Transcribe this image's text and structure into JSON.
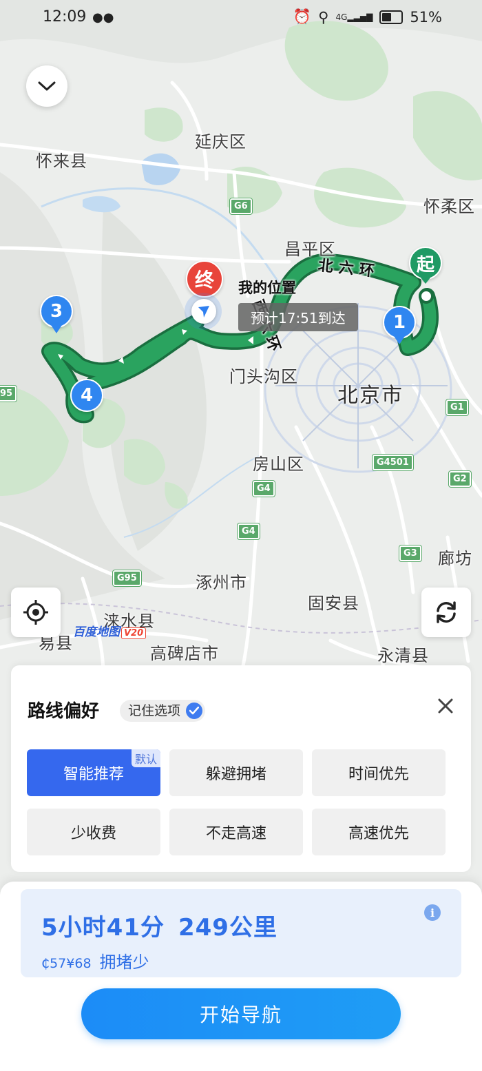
{
  "status_bar": {
    "time": "12:09",
    "network": "4G",
    "battery": "51%"
  },
  "map": {
    "places": {
      "yanqing": "延庆区",
      "huailai": "怀来县",
      "huairou": "怀柔区",
      "changping": "昌平区",
      "mentougou": "门头沟区",
      "beijing": "北京市",
      "fangshan": "房山区",
      "langfang": "廊坊",
      "zhuozhou": "涿州市",
      "guan": "固安县",
      "laishui": "涞水县",
      "yixian": "易县",
      "gaobeidian": "高碑店市",
      "yongqing": "永清县"
    },
    "shields": {
      "g6": "G6",
      "g1": "G1",
      "g4501": "G4501",
      "g2": "G2",
      "g4a": "G4",
      "g4b": "G4",
      "g3": "G3",
      "g95a": "G95",
      "g95b": "95"
    },
    "road_labels": {
      "ring6_north": "北六环",
      "ring6_west": "西六环"
    },
    "markers": {
      "start": "起",
      "end": "终",
      "wp1": "1",
      "wp3": "3",
      "wp4": "4"
    },
    "my_location_label": "我的位置",
    "eta": "预计17:51到达",
    "logo": "百度地图",
    "logo_version": "V20",
    "colors": {
      "route": "#2a9d5c",
      "route_border": "#1e7a45",
      "start_marker": "#1f9a64",
      "end_marker": "#e8443a",
      "waypoint": "#2f86f0"
    }
  },
  "preferences": {
    "title": "路线偏好",
    "remember_label": "记住选项",
    "default_tag": "默认",
    "options": [
      {
        "label": "智能推荐",
        "active": true
      },
      {
        "label": "躲避拥堵",
        "active": false
      },
      {
        "label": "时间优先",
        "active": false
      },
      {
        "label": "少收费",
        "active": false
      },
      {
        "label": "不走高速",
        "active": false
      },
      {
        "label": "高速优先",
        "active": false
      }
    ]
  },
  "route": {
    "duration": "5小时41分",
    "distance": "249公里",
    "toll": "57",
    "fuel": "¥68",
    "traffic": "拥堵少"
  },
  "navigate_button": "开始导航"
}
